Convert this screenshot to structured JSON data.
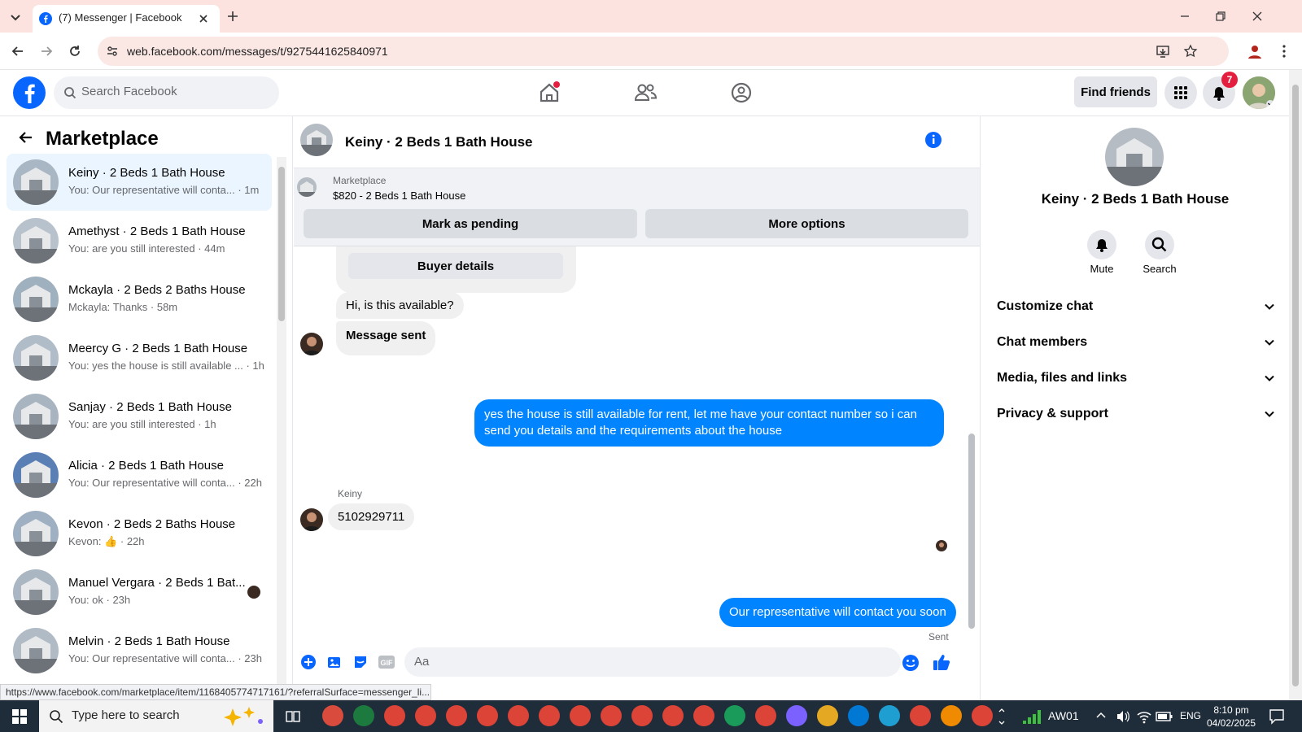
{
  "browser": {
    "tab_title": "(7) Messenger | Facebook",
    "url": "web.facebook.com/messages/t/9275441625840971",
    "status_url": "https://www.facebook.com/marketplace/item/1168405774717161/?referralSurface=messenger_li..."
  },
  "header": {
    "search_placeholder": "Search Facebook",
    "find_friends": "Find friends",
    "notification_count": "7"
  },
  "sidebar": {
    "title": "Marketplace",
    "conversations": [
      {
        "name": "Keiny · 2 Beds 1 Bath House",
        "snippet": "You: Our representative will conta... · 1m"
      },
      {
        "name": "Amethyst · 2 Beds 1 Bath House",
        "snippet": "You: are you still interested · 44m"
      },
      {
        "name": "Mckayla · 2 Beds 2 Baths House",
        "snippet": "Mckayla: Thanks · 58m"
      },
      {
        "name": "Meercy G · 2 Beds 1 Bath House",
        "snippet": "You: yes the house is still available ... · 1h"
      },
      {
        "name": "Sanjay · 2 Beds 1 Bath House",
        "snippet": "You: are you still interested · 1h"
      },
      {
        "name": "Alicia · 2 Beds 1 Bath House",
        "snippet": "You: Our representative will conta... · 22h"
      },
      {
        "name": "Kevon · 2 Beds 2 Baths House",
        "snippet": "Kevon: 👍 · 22h"
      },
      {
        "name": "Manuel Vergara · 2 Beds 1 Bat...",
        "snippet": "You: ok · 23h"
      },
      {
        "name": "Melvin · 2 Beds 1 Bath House",
        "snippet": "You: Our representative will conta... · 23h"
      }
    ]
  },
  "chat": {
    "title": "Keiny · 2 Beds 1 Bath House",
    "marketplace_label": "Marketplace",
    "listing": "$820 - 2 Beds 1 Bath House",
    "mark_pending": "Mark as pending",
    "more_options": "More options",
    "buyer_details": "Buyer details",
    "msg_available": "Hi, is this available?",
    "msg_sent": "Message sent",
    "msg_reply": "yes the house is still available for rent, let me have your contact number so i can send you details and the requirements about the house",
    "sender_name": "Keiny",
    "msg_number": "5102929711",
    "msg_final": "Our representative will contact you soon",
    "sent_label": "Sent",
    "composer_placeholder": "Aa"
  },
  "info_panel": {
    "title": "Keiny · 2 Beds 1 Bath House",
    "mute": "Mute",
    "search": "Search",
    "sections": [
      "Customize chat",
      "Chat members",
      "Media, files and links",
      "Privacy & support"
    ]
  },
  "taskbar": {
    "search_placeholder": "Type here to search",
    "network": "AW01",
    "lang": "ENG",
    "time": "8:10 pm",
    "date": "04/02/2025"
  },
  "colors": {
    "fb_blue": "#0866ff",
    "messenger_blue": "#0084ff",
    "notif_red": "#e41e3f"
  }
}
